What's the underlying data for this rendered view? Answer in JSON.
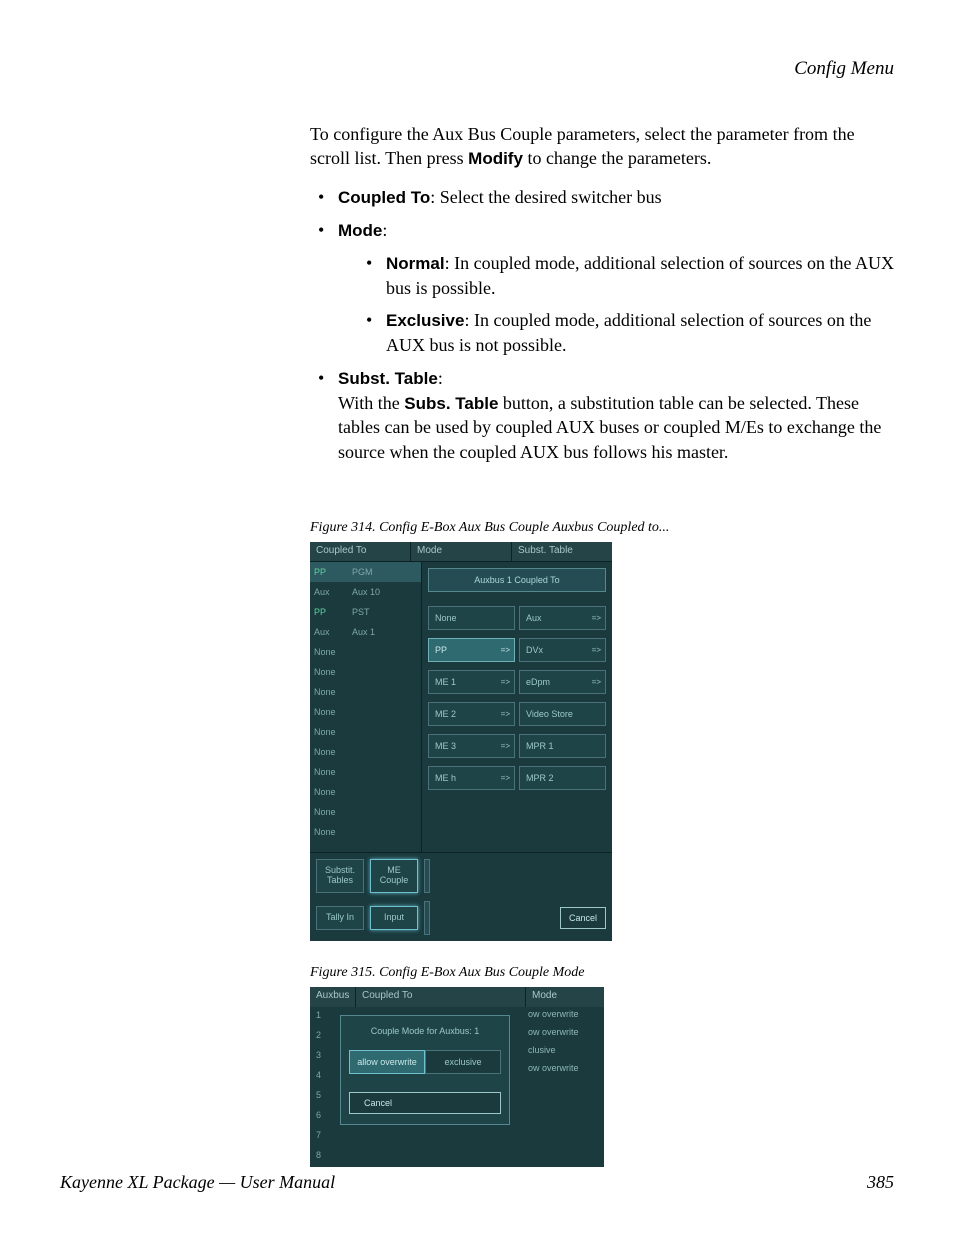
{
  "header": {
    "section": "Config Menu"
  },
  "intro": {
    "line1": "To configure the Aux Bus Couple parameters, select the parameter from the scroll list. Then press ",
    "modify": "Modify",
    "line2": " to change the parameters."
  },
  "bullets": {
    "coupled_to": {
      "label": "Coupled To",
      "text": ": Select the desired switcher bus"
    },
    "mode": {
      "label": "Mode",
      "colon": ":"
    },
    "normal": {
      "label": "Normal",
      "text": ": In coupled mode, additional selection of sources on the AUX bus is possible."
    },
    "exclusive": {
      "label": "Exclusive",
      "text": ": In coupled mode, additional selection of sources on the AUX bus is not possible."
    },
    "subst": {
      "label": "Subst. Table",
      "colon": ":",
      "line1a": "With the ",
      "subs_table": "Subs. Table",
      "line1b": " button, a substitution table can be selected. These tables can be used by coupled AUX buses or coupled M/Es to exchange the source when the coupled AUX bus follows his master."
    }
  },
  "fig314": {
    "caption": "Figure 314.  Config E-Box Aux Bus Couple Auxbus Coupled to...",
    "headers": {
      "coupled_to": "Coupled To",
      "mode": "Mode",
      "subst_table": "Subst. Table"
    },
    "left_rows": [
      {
        "c1": "PP",
        "c2": "PGM",
        "pp": true,
        "selected": true
      },
      {
        "c1": "Aux",
        "c2": "Aux 10"
      },
      {
        "c1": "PP",
        "c2": "PST",
        "pp": true
      },
      {
        "c1": "Aux",
        "c2": "Aux 1"
      },
      {
        "c1": "None",
        "c2": ""
      },
      {
        "c1": "None",
        "c2": ""
      },
      {
        "c1": "None",
        "c2": ""
      },
      {
        "c1": "None",
        "c2": ""
      },
      {
        "c1": "None",
        "c2": ""
      },
      {
        "c1": "None",
        "c2": ""
      },
      {
        "c1": "None",
        "c2": ""
      },
      {
        "c1": "None",
        "c2": ""
      },
      {
        "c1": "None",
        "c2": ""
      },
      {
        "c1": "None",
        "c2": ""
      }
    ],
    "right_title": "Auxbus 1 Coupled To",
    "pairs": [
      {
        "a": "None",
        "b": "Aux",
        "a_arrow": false,
        "b_arrow": true
      },
      {
        "a": "PP",
        "b": "DVx",
        "a_arrow": true,
        "b_arrow": true,
        "a_active": true
      },
      {
        "a": "ME 1",
        "b": "eDpm",
        "a_arrow": true,
        "b_arrow": true
      },
      {
        "a": "ME 2",
        "b": "Video Store",
        "a_arrow": true,
        "b_arrow": false
      },
      {
        "a": "ME 3",
        "b": "MPR 1",
        "a_arrow": true,
        "b_arrow": false
      },
      {
        "a": "ME h",
        "b": "MPR 2",
        "a_arrow": true,
        "b_arrow": false
      }
    ],
    "bottom": {
      "substit_tables": "Substit.\nTables",
      "me_couple": "ME\nCouple",
      "tally_in": "Tally In",
      "input": "Input",
      "cancel": "Cancel"
    }
  },
  "fig315": {
    "caption": "Figure 315.  Config E-Box Aux Bus Couple Mode",
    "headers": {
      "auxbus": "Auxbus",
      "coupled_to": "Coupled To",
      "mode": "Mode"
    },
    "numbers": [
      "1",
      "2",
      "3",
      "4",
      "5",
      "6",
      "7",
      "8"
    ],
    "right_labels": [
      "ow overwrite",
      "ow overwrite",
      "clusive",
      "ow overwrite"
    ],
    "dialog": {
      "title": "Couple Mode for Auxbus: 1",
      "allow_overwrite": "allow overwrite",
      "exclusive": "exclusive",
      "cancel": "Cancel"
    }
  },
  "footer": {
    "left": "Kayenne XL Package — User Manual",
    "page": "385"
  }
}
